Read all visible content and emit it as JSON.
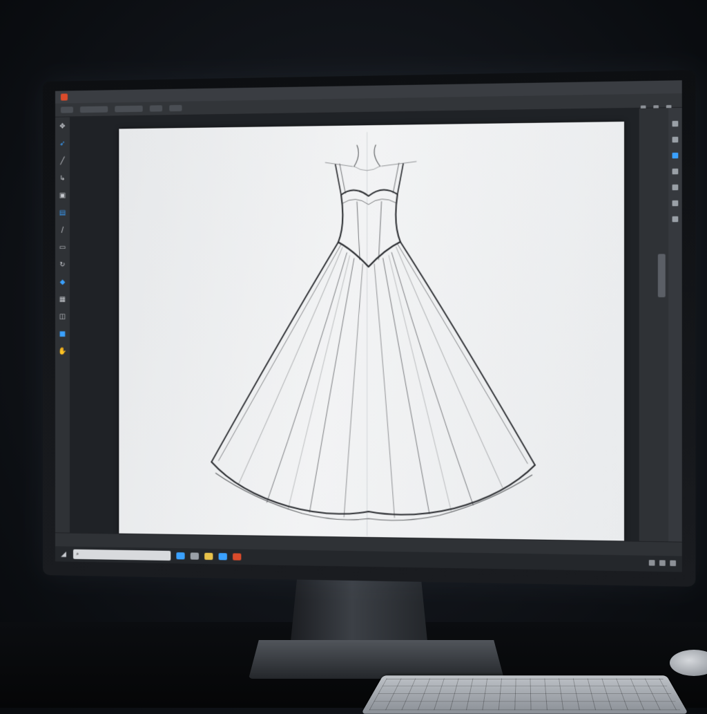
{
  "scene": {
    "subject": "fashion-sketch-on-monitor"
  },
  "app": {
    "accent_color": "#d94b2b",
    "menu_items": [
      "",
      "",
      "",
      "",
      "",
      "",
      ""
    ],
    "tools": [
      {
        "icon": "move-icon",
        "glyph": "✥",
        "blue": false
      },
      {
        "icon": "brush-icon",
        "glyph": "➶",
        "blue": true
      },
      {
        "icon": "pen-icon",
        "glyph": "╱",
        "blue": false
      },
      {
        "icon": "lasso-icon",
        "glyph": "↳",
        "blue": false
      },
      {
        "icon": "layer-icon",
        "glyph": "▣",
        "blue": false
      },
      {
        "icon": "eraser-icon",
        "glyph": "▤",
        "blue": true
      },
      {
        "icon": "line-icon",
        "glyph": "/",
        "blue": false
      },
      {
        "icon": "shape-icon",
        "glyph": "▭",
        "blue": false
      },
      {
        "icon": "rotate-icon",
        "glyph": "↻",
        "blue": false
      },
      {
        "icon": "bucket-icon",
        "glyph": "◆",
        "blue": true
      },
      {
        "icon": "stamp-icon",
        "glyph": "▦",
        "blue": false
      },
      {
        "icon": "frame-icon",
        "glyph": "◫",
        "blue": false
      },
      {
        "icon": "color-icon",
        "glyph": "■",
        "blue": true
      },
      {
        "icon": "hand-icon",
        "glyph": "✋",
        "blue": false
      }
    ],
    "panel_icons": [
      {
        "icon": "layers-panel-icon",
        "blue": false
      },
      {
        "icon": "cloud-panel-icon",
        "blue": false
      },
      {
        "icon": "color-panel-icon",
        "blue": true
      },
      {
        "icon": "brush-panel-icon",
        "blue": false
      },
      {
        "icon": "history-panel-icon",
        "blue": false
      },
      {
        "icon": "adjust-panel-icon",
        "blue": false
      },
      {
        "icon": "properties-panel-icon",
        "blue": false
      }
    ],
    "taskbar_icons": [
      {
        "icon": "cloud-taskbar-icon",
        "color": "#3aa1ff"
      },
      {
        "icon": "photo-taskbar-icon",
        "color": "#9aa0a7"
      },
      {
        "icon": "folder-taskbar-icon",
        "color": "#e8c24a"
      },
      {
        "icon": "mail-taskbar-icon",
        "color": "#3aa1ff"
      },
      {
        "icon": "app-taskbar-icon",
        "color": "#d94b2b"
      }
    ]
  }
}
